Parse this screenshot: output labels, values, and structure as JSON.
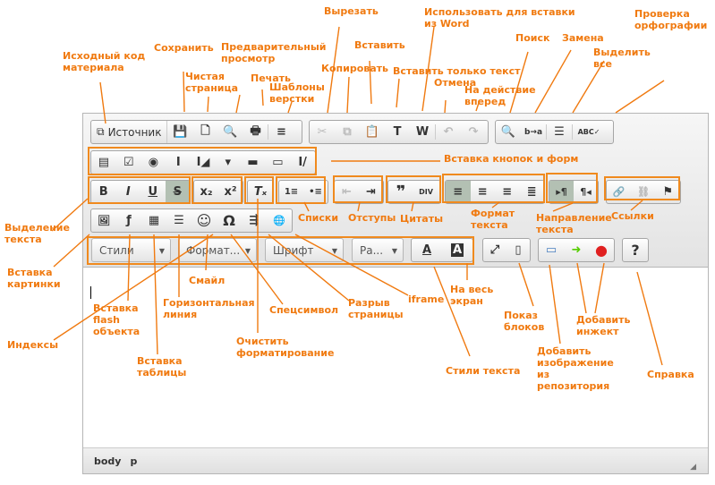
{
  "toolbar": {
    "source_label": "Источник",
    "styles_combo": "Стили",
    "format_combo": "Формат...",
    "font_combo": "Шрифт",
    "size_combo": "Ра...",
    "icons": {
      "save": "💾",
      "new": "🗋",
      "preview": "🔍",
      "print": "🖶",
      "templates": "≡",
      "cut": "✂",
      "copy": "⧉",
      "paste": "📋",
      "paste_text": "T",
      "paste_word": "W",
      "undo": "↶",
      "redo": "↷",
      "find": "🔍",
      "replace": "b→a",
      "select_all": "☰",
      "spell": "ABC✓",
      "form": "▤",
      "checkbox": "☑",
      "radio": "◉",
      "textfield": "I",
      "textarea": "I◢",
      "select": "▾",
      "button": "▬",
      "imagebutton": "▭",
      "hidden": "I/",
      "bold": "B",
      "italic": "I",
      "underline": "U",
      "strike": "S",
      "sub": "x₂",
      "sup": "x²",
      "removeformat": "Tₓ",
      "ol": "1≡",
      "ul": "•≡",
      "outdent": "⇤",
      "indent": "⇥",
      "blockquote": "❞",
      "div": "DIV",
      "left": "≡",
      "center": "≡",
      "right": "≡",
      "justify": "≣",
      "ltr": "▸¶",
      "rtl": "¶◂",
      "link": "🔗",
      "unlink": "⛓",
      "anchor": "⚑",
      "image": "🖼",
      "flash": "ƒ",
      "table": "▦",
      "hr": "☰",
      "smiley": "☺",
      "specialchar": "Ω",
      "pagebreak": "⇶",
      "iframe": "🌐",
      "textcolor": "A",
      "bgcolor": "A",
      "maximize": "⤢",
      "showblocks": "▯",
      "repo_image": "▭",
      "inject": "➜",
      "stop": "●",
      "help": "?"
    }
  },
  "statusbar": {
    "path": [
      "body",
      "p"
    ]
  },
  "annotations": {
    "source": "Исходный код\nматериала",
    "save": "Сохранить",
    "preview": "Предварительный\nпросмотр",
    "new_page": "Чистая\nстраница",
    "print": "Печать",
    "templates": "Шаблоны\nверстки",
    "cut": "Вырезать",
    "copy": "Копировать",
    "paste": "Вставить",
    "paste_word": "Использовать для вставки\nиз Word",
    "paste_text": "Вставить только текст",
    "undo": "Отмена",
    "redo": "На действие\nвперед",
    "find": "Поиск",
    "replace": "Замена",
    "select_all": "Выделить\nвсе",
    "spell": "Проверка\nорфографии",
    "forms": "Вставка кнопок и форм",
    "text_select": "Выделение\nтекста",
    "insert_image": "Вставка\nкартинки",
    "lists": "Списки",
    "indents": "Отступы",
    "quotes": "Цитаты",
    "text_format": "Формат\nтекста",
    "text_direction": "Направление\nтекста",
    "links": "Ссылки",
    "smiley": "Смайл",
    "hr": "Горизонтальная\nлиния",
    "specialchar": "Спецсимвол",
    "pagebreak": "Разрыв\nстраницы",
    "iframe": "iframe",
    "maximize": "На весь\nэкран",
    "showblocks": "Показ\nблоков",
    "inject": "Добавить\nинжект",
    "flash": "Вставка\nflash\nобъекта",
    "indexes": "Индексы",
    "removeformat": "Очистить\nформатирование",
    "table": "Вставка\nтаблицы",
    "text_styles": "Стили текста",
    "repo_image": "Добавить\nизображение\nиз\nрепозитория",
    "help": "Справка"
  },
  "colors": {
    "annotation": "#f07a10"
  }
}
